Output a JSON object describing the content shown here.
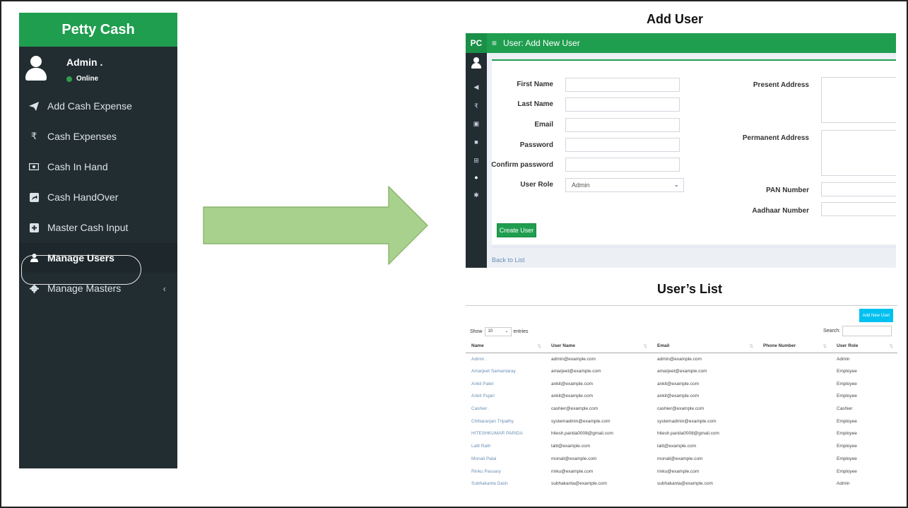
{
  "sidebar": {
    "app_title": "Petty Cash",
    "user_name": "Admin .",
    "user_status": "Online",
    "items": [
      {
        "label": "Add Cash Expense",
        "icon": "paper-plane-icon"
      },
      {
        "label": "Cash Expenses",
        "icon": "rupee-icon"
      },
      {
        "label": "Cash In Hand",
        "icon": "money-icon"
      },
      {
        "label": "Cash HandOver",
        "icon": "share-square-icon"
      },
      {
        "label": "Master Cash Input",
        "icon": "plus-square-icon"
      },
      {
        "label": "Manage Users",
        "icon": "user-icon"
      },
      {
        "label": "Manage Masters",
        "icon": "gear-icon"
      }
    ]
  },
  "headings": {
    "add_user": "Add User",
    "users_list": "User’s List"
  },
  "add_user_form": {
    "logo": "PC",
    "title": "User: Add New User",
    "first_name_label": "First Name",
    "last_name_label": "Last Name",
    "email_label": "Email",
    "password_label": "Password",
    "confirm_password_label": "Confirm password",
    "user_role_label": "User Role",
    "user_role_value": "Admin",
    "present_address_label": "Present Address",
    "permanent_address_label": "Permanent Address",
    "pan_label": "PAN Number",
    "aadhaar_label": "Aadhaar Number",
    "create_button": "Create User",
    "back_link": "Back to List"
  },
  "users_list": {
    "add_button": "Add New User",
    "show_label": "Show",
    "show_value": "10",
    "entries_label": "entries",
    "search_label": "Search:",
    "columns": [
      "Name",
      "User Name",
      "Email",
      "Phone Number",
      "User Role"
    ],
    "rows": [
      [
        "Admin .",
        "admin@example.com",
        "admin@example.com",
        "",
        "Admin"
      ],
      [
        "Amarjeet Samantaray",
        "amarjeet@example.com",
        "amarjeet@example.com",
        "",
        "Employee"
      ],
      [
        "Ankit Patel",
        "ankit@example.com",
        "ankit@example.com",
        "",
        "Employee"
      ],
      [
        "Ankit Pujari",
        "ankit@example.com",
        "ankit@example.com",
        "",
        "Employee"
      ],
      [
        "Cashier .",
        "cashier@example.com",
        "cashier@example.com",
        "",
        "Cashier"
      ],
      [
        "Chittaranjan Tripathy",
        "systemadmin@example.com",
        "systemadmin@example.com",
        "",
        "Employee"
      ],
      [
        "HITESHKUMAR PARIDA",
        "hitesh.parida0008@gmail.com",
        "hitesh.parida0008@gmail.com",
        "",
        "Employee"
      ],
      [
        "Lalit Rath",
        "lalit@example.com",
        "lalit@example.com",
        "",
        "Employee"
      ],
      [
        "Monali Palai",
        "monali@example.com",
        "monali@example.com",
        "",
        "Employee"
      ],
      [
        "Rinku Passary",
        "rinku@example.com",
        "rinku@example.com",
        "",
        "Employee"
      ],
      [
        "Subhakanta Dash",
        "subhakanta@example.com",
        "subhakanta@example.com",
        "",
        "Admin"
      ]
    ]
  },
  "colors": {
    "brand_green": "#1f9e4f",
    "sidebar_dark": "#222d32",
    "arrow_fill": "#a9d18e",
    "add_button": "#00c0ef"
  }
}
